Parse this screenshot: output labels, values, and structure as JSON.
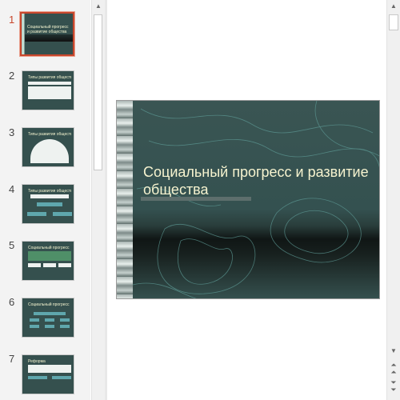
{
  "thumbnails": [
    {
      "number": "1",
      "title": "Социальный прогресс и развитие общества",
      "active": true
    },
    {
      "number": "2",
      "title": "Типы развития общества"
    },
    {
      "number": "3",
      "title": "Типы развития общества"
    },
    {
      "number": "4",
      "title": "Типы развития общества"
    },
    {
      "number": "5",
      "title": "Социальный прогресс"
    },
    {
      "number": "6",
      "title": "Социальный прогресс"
    },
    {
      "number": "7",
      "title": "Реформа"
    }
  ],
  "slide": {
    "title": "Социальный прогресс и развитие общества"
  },
  "scrollbar": {
    "up_icon": "arrow-up-icon",
    "down_icon": "arrow-down-icon",
    "prev_slide_icon": "double-chevron-up-icon",
    "next_slide_icon": "double-chevron-down-icon"
  },
  "colors": {
    "accent": "#c8472c",
    "slide_bg": "#35504e",
    "title_text": "#f6f3cf"
  }
}
